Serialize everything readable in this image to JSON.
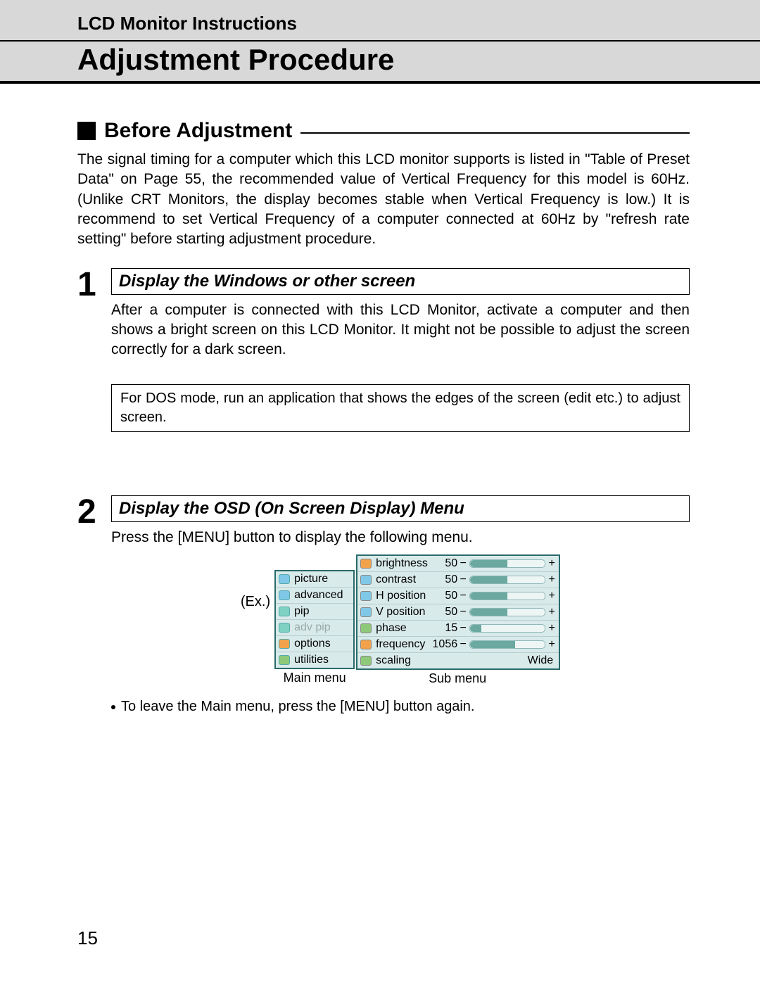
{
  "header": {
    "subtitle": "LCD Monitor Instructions",
    "title": "Adjustment Procedure"
  },
  "section": {
    "title": "Before Adjustment",
    "body": "The signal timing for a computer which this LCD monitor supports is listed in \"Table of Preset Data\" on Page 55, the recommended value of Vertical Frequency for this model is 60Hz. (Unlike CRT Monitors, the display becomes stable when Vertical Frequency is low.) It is recommend to set Vertical Frequency of a computer connected at 60Hz by \"refresh rate setting\" before starting adjustment procedure."
  },
  "step1": {
    "num": "1",
    "title": "Display the Windows or other screen",
    "body": "After a computer is connected with this LCD Monitor, activate a computer and then shows a bright screen on this LCD Monitor. It might not be possible to adjust the screen correctly for a dark screen.",
    "note": "For DOS mode, run an application that shows the edges of the screen (edit etc.) to adjust screen."
  },
  "step2": {
    "num": "2",
    "title": "Display the OSD (On Screen Display) Menu",
    "body": "Press the [MENU] button to display the following menu.",
    "ex_label": "(Ex.)",
    "main_caption": "Main menu",
    "sub_caption": "Sub menu",
    "bullet": "To leave the Main menu, press the [MENU] button again."
  },
  "osd": {
    "main": [
      {
        "label": "picture",
        "icon": "ic-blue",
        "dim": false
      },
      {
        "label": "advanced",
        "icon": "ic-blue",
        "dim": false
      },
      {
        "label": "pip",
        "icon": "ic-teal",
        "dim": false
      },
      {
        "label": "adv pip",
        "icon": "ic-teal",
        "dim": true
      },
      {
        "label": "options",
        "icon": "ic-orange",
        "dim": false
      },
      {
        "label": "utilities",
        "icon": "ic-green",
        "dim": false
      }
    ],
    "sub": [
      {
        "label": "brightness",
        "value": "50",
        "fill": 50,
        "icon": "ic-orange"
      },
      {
        "label": "contrast",
        "value": "50",
        "fill": 50,
        "icon": "ic-blue"
      },
      {
        "label": "H position",
        "value": "50",
        "fill": 50,
        "icon": "ic-blue"
      },
      {
        "label": "V position",
        "value": "50",
        "fill": 50,
        "icon": "ic-blue"
      },
      {
        "label": "phase",
        "value": "15",
        "fill": 15,
        "icon": "ic-green"
      },
      {
        "label": "frequency",
        "value": "1056",
        "fill": 60,
        "icon": "ic-orange"
      },
      {
        "label": "scaling",
        "value": "",
        "wide": "Wide",
        "icon": "ic-green"
      }
    ],
    "minus": "−",
    "plus": "+"
  },
  "page_number": "15"
}
